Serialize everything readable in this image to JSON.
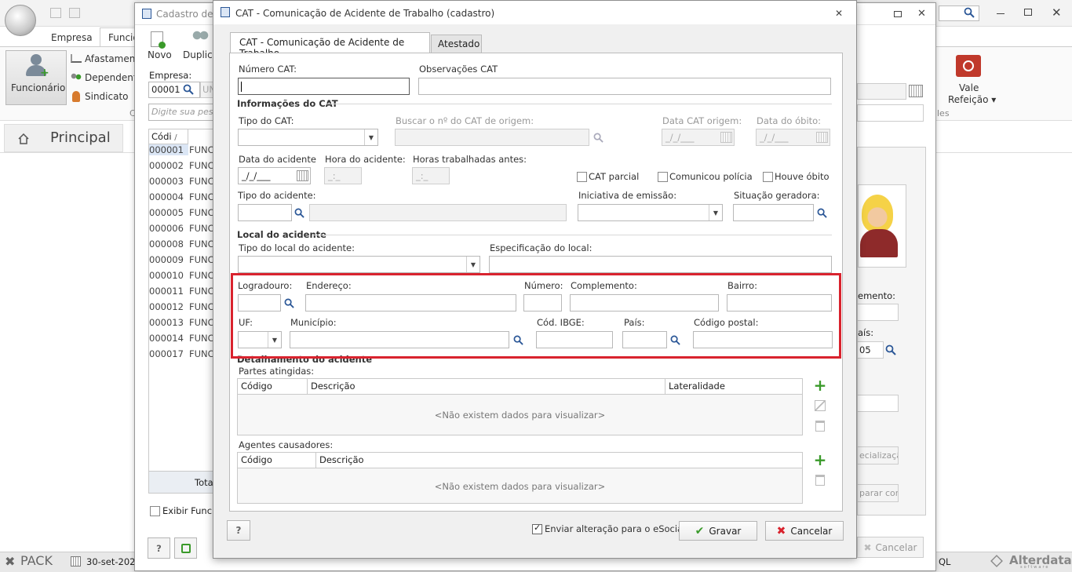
{
  "bg": {
    "tabs": [
      "Empresa",
      "Funcio"
    ],
    "ribbon": {
      "funcionario": "Funcionário",
      "afastamento": "Afastament",
      "dependente": "Dependente",
      "sindicato": "Sindicato",
      "vale1": "Vale",
      "vale2": "Refeição",
      "group_c": "C",
      "group_les": "les"
    },
    "principal": "Principal",
    "status": {
      "pack": "PACK",
      "date": "30-set-2021",
      "ql": "QL",
      "brand": "Alterdata",
      "brand_sub": "software"
    }
  },
  "cadastro": {
    "title": "Cadastro de F",
    "toolbar": {
      "novo": "Novo",
      "duplicar": "Duplica"
    },
    "empresa_label": "Empresa:",
    "empresa_value": "00001",
    "empresa_name": "UN",
    "search_placeholder": "Digite sua pesqu",
    "col_codigo": "Códi",
    "col_sort": "/",
    "rows": [
      {
        "code": "000001",
        "name": "FUNC"
      },
      {
        "code": "000002",
        "name": "FUNC"
      },
      {
        "code": "000003",
        "name": "FUNC"
      },
      {
        "code": "000004",
        "name": "FUNC"
      },
      {
        "code": "000005",
        "name": "FUNC"
      },
      {
        "code": "000006",
        "name": "FUNC"
      },
      {
        "code": "000008",
        "name": "FUNC"
      },
      {
        "code": "000009",
        "name": "FUNC"
      },
      {
        "code": "000010",
        "name": "FUNC"
      },
      {
        "code": "000011",
        "name": "FUNC"
      },
      {
        "code": "000012",
        "name": "FUNC"
      },
      {
        "code": "000013",
        "name": "FUNC"
      },
      {
        "code": "000014",
        "name": "FUNC"
      },
      {
        "code": "000017",
        "name": "FUNC"
      }
    ],
    "total": "Tota",
    "exibir": "Exibir Funcio",
    "right": {
      "emento": "emento:",
      "ais": "aís:",
      "code05": "05",
      "especializ": "ecializaçã",
      "parar": "parar com",
      "cancelar": "Cancelar"
    }
  },
  "dialog": {
    "title": "CAT - Comunicação de Acidente de Trabalho (cadastro)",
    "tabs": {
      "main": "CAT - Comunicação de Acidente de Trabalho",
      "atestado": "Atestado"
    },
    "numero_cat": "Número CAT:",
    "obs_cat": "Observações CAT",
    "informacoes": "Informações do CAT",
    "tipo_cat": "Tipo do CAT:",
    "buscar_origem": "Buscar o nº do CAT de origem:",
    "data_origem": "Data CAT origem:",
    "data_obito": "Data do óbito:",
    "date_mask": "_/_/___",
    "time_mask": "_:_",
    "data_acidente": "Data do acidente",
    "hora_acidente": "Hora do acidente:",
    "horas_trab": "Horas trabalhadas antes:",
    "cat_parcial": "CAT parcial",
    "comunicou": "Comunicou polícia",
    "houve_obito": "Houve óbito",
    "tipo_acidente": "Tipo do acidente:",
    "iniciativa": "Iniciativa de emissão:",
    "situacao": "Situação geradora:",
    "local_acidente": "Local do acidente",
    "tipo_local": "Tipo do local do acidente:",
    "especificacao": "Especificação do local:",
    "logradouro": "Logradouro:",
    "endereco": "Endereço:",
    "numero": "Número:",
    "complemento": "Complemento:",
    "bairro": "Bairro:",
    "uf": "UF:",
    "municipio": "Município:",
    "ibge": "Cód. IBGE:",
    "pais": "País:",
    "codigo_postal": "Código postal:",
    "detalhamento": "Detalhamento do acidente",
    "partes": "Partes atingidas:",
    "partes_cols": [
      "Código",
      "Descrição",
      "Lateralidade"
    ],
    "empty": "<Não existem dados para visualizar>",
    "agentes": "Agentes causadores:",
    "agentes_cols": [
      "Código",
      "Descrição"
    ],
    "enviar": "Enviar alteração para o eSocial",
    "gravar": "Gravar",
    "cancelar": "Cancelar",
    "help": "?"
  },
  "colors": {
    "highlight": "#d9232e",
    "accent_green": "#3a9a2a"
  }
}
